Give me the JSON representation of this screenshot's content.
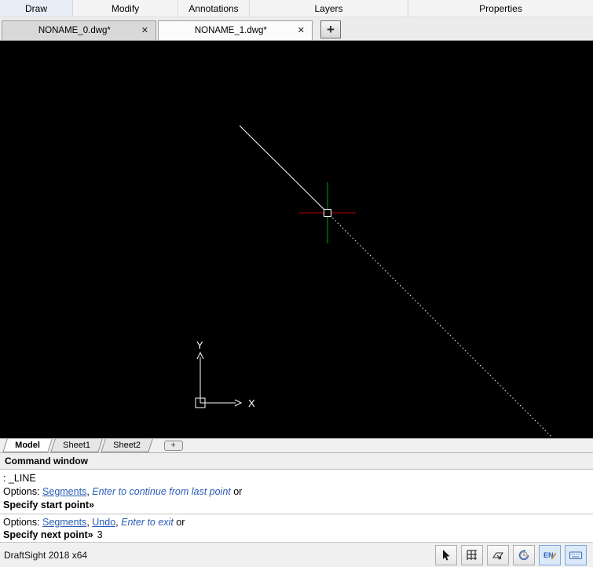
{
  "colors": {
    "canvas_bg": "#000000",
    "drawn_line": "#ffffff",
    "crosshair_vertical": "#00a800",
    "crosshair_horizontal": "#b40000",
    "link_blue": "#2a5db8"
  },
  "menu": {
    "items": [
      {
        "label": "Draw"
      },
      {
        "label": "Modify"
      },
      {
        "label": "Annotations"
      },
      {
        "label": "Layers"
      },
      {
        "label": "Properties"
      }
    ]
  },
  "doc_tabs": {
    "tabs": [
      {
        "label": "NONAME_0.dwg*",
        "close": "✕"
      },
      {
        "label": "NONAME_1.dwg*",
        "close": "✕"
      }
    ],
    "new_tab_label": "+"
  },
  "canvas": {
    "ucs": {
      "x_label": "X",
      "y_label": "Y"
    }
  },
  "sheet_tabs": {
    "tabs": [
      {
        "label": "Model"
      },
      {
        "label": "Sheet1"
      },
      {
        "label": "Sheet2"
      }
    ],
    "add_label": "+"
  },
  "command_window": {
    "title": "Command window",
    "history": {
      "line1": ": _LINE",
      "opts1_label": "Options: ",
      "opts1_link1": "Segments",
      "opts1_sep1": ", ",
      "opts1_enter": "Enter to continue from last point",
      "opts1_tail": " or",
      "prompt1": "Specify start point»"
    },
    "current": {
      "opts2_label": "Options: ",
      "opts2_link1": "Segments",
      "opts2_sep1": ", ",
      "opts2_link2": "Undo",
      "opts2_sep2": ", ",
      "opts2_enter": "Enter to exit",
      "opts2_tail": " or",
      "prompt2": "Specify next point»",
      "input_value": "3"
    }
  },
  "status_bar": {
    "app_label": "DraftSight 2018 x64",
    "language_label": "EN"
  }
}
